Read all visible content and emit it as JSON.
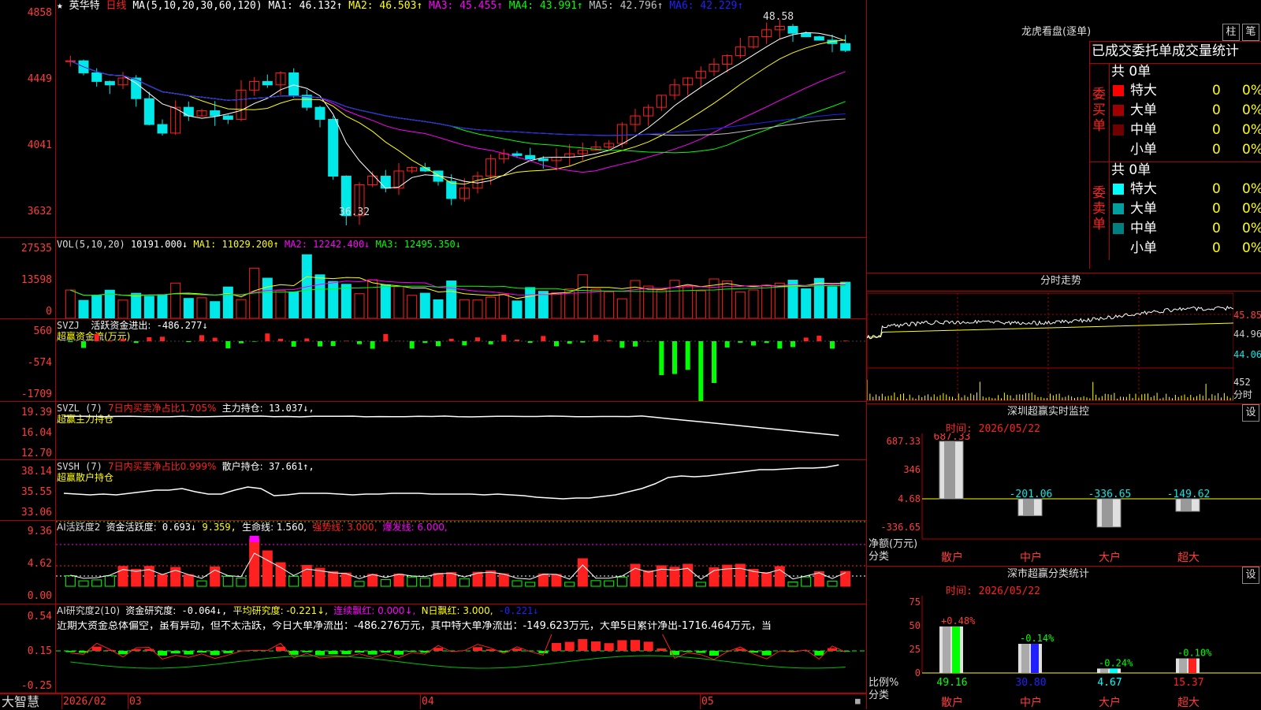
{
  "colors": {
    "up": "#ff2020",
    "down": "#00e8e8",
    "ma1": "#ffffff",
    "ma2": "#ffff00",
    "ma3": "#ff00ff",
    "ma4": "#00ff00",
    "ma5": "#c0c0c0",
    "ma6": "#2020ff",
    "axis": "#ff3c3c",
    "grid": "#b00000"
  },
  "header": {
    "star": "★",
    "name": "英华特",
    "period": "日线",
    "ma_def": "MA(5,10,20,30,60,120)",
    "ma1": "MA1: 46.132↑",
    "ma2": "MA2: 46.503↑",
    "ma3": "MA3: 45.455↑",
    "ma4": "MA4: 43.991↑",
    "ma5": "MA5: 42.796↑",
    "ma6": "MA6: 42.229↑"
  },
  "kline": {
    "yticks": [
      "4858",
      "4449",
      "4041",
      "3632"
    ],
    "high_label": "48.58",
    "low_label": "36.32"
  },
  "vol": {
    "title": "VOL(5,10,20)",
    "v": "10191.000↓",
    "ma1": "MA1: 11029.200↑",
    "ma2": "MA2: 12242.400↓",
    "ma3": "MA3: 12495.350↓",
    "yticks": [
      "27535",
      "13598",
      "0"
    ]
  },
  "svzj": {
    "title": "SVZJ",
    "label": "活跃资金进出:",
    "value": "-486.277↓",
    "subtitle": "超赢资金流(万元)",
    "yticks": [
      "560",
      "-574",
      "-1709"
    ]
  },
  "svzl": {
    "title": "SVZL (7)",
    "ratio": "7日内买卖净占比1.705%",
    "main_label": "主力持仓:",
    "main_value": "13.037↓,",
    "subtitle": "超赢主力持仓",
    "yticks": [
      "19.39",
      "16.04",
      "12.70"
    ]
  },
  "svsh": {
    "title": "SVSH (7)",
    "ratio": "7日内买卖净占比0.999%",
    "label": "散户持仓:",
    "value": "37.661↑,",
    "subtitle": "超赢散户持仓",
    "yticks": [
      "38.14",
      "35.55",
      "33.06"
    ]
  },
  "ai2": {
    "title": "AI活跃度2",
    "label": "资金活跃度:",
    "value": "0.693↓",
    "v2": "9.359,",
    "life": "生命线: 1.560,",
    "strong": "强势线: 3.000,",
    "burst": "爆发线: 6.000,",
    "yticks": [
      "9.36",
      "4.62",
      "0.00"
    ]
  },
  "ai3": {
    "title": "AI研究度2(10)",
    "label": "资金研究度:",
    "value": "-0.064↓,",
    "avg": "平均研究度: -0.221↓,",
    "cont": "连续飘红: 0.000↓,",
    "nday": "N日飘红: 3.000,",
    "last": "-0.221↓",
    "comment": "近期大资金总体偏空，虽有异动，但不太活跃，今日大单净流出：-486.276万元，其中特大单净流出：-149.623万元，大单5日累计净出-1716.464万元，当",
    "yticks": [
      "0.54",
      "0.15",
      "-0.25"
    ]
  },
  "footer": {
    "brand": "大智慧",
    "dates": [
      "2026/02",
      "03",
      "04",
      "05"
    ]
  },
  "lhb": {
    "title": "龙虎看盘(逐单)",
    "btn_zhu": "柱",
    "btn_bi": "笔",
    "header": "已成交委托单成交量统计",
    "buy_label": "委买单",
    "sell_label": "委卖单",
    "buy_total": "共 0单",
    "sell_total": "共 0单",
    "buy_rows": [
      {
        "name": "特大",
        "n": "0",
        "p": "0%",
        "c": "#ff0000"
      },
      {
        "name": "大单",
        "n": "0",
        "p": "0%",
        "c": "#a00000"
      },
      {
        "name": "中单",
        "n": "0",
        "p": "0%",
        "c": "#700000"
      },
      {
        "name": "小单",
        "n": "0",
        "p": "0%",
        "c": "#000000"
      }
    ],
    "sell_rows": [
      {
        "name": "特大",
        "n": "0",
        "p": "0%",
        "c": "#00ffff"
      },
      {
        "name": "大单",
        "n": "0",
        "p": "0%",
        "c": "#00a0a0"
      },
      {
        "name": "中单",
        "n": "0",
        "p": "0%",
        "c": "#008080"
      },
      {
        "name": "小单",
        "n": "0",
        "p": "0%",
        "c": "#000000"
      }
    ]
  },
  "fenshi": {
    "title": "分时走势",
    "yticks": [
      "45.85",
      "44.96",
      "44.06"
    ],
    "vol_tick": "452",
    "vol_label": "分时"
  },
  "sz_monitor": {
    "title": "深圳超赢实时监控",
    "btn": "设",
    "time": "时间: 2026/05/22",
    "yticks": [
      "687.33",
      "346",
      "4.68",
      "-336.65"
    ],
    "ylabel": "净额(万元)",
    "xlabel": "分类",
    "bars": [
      {
        "cat": "散户",
        "val": "687.33"
      },
      {
        "cat": "中户",
        "val": "-201.06"
      },
      {
        "cat": "大户",
        "val": "-336.65"
      },
      {
        "cat": "超大",
        "val": "-149.62"
      }
    ]
  },
  "sz_stat": {
    "title": "深市超赢分类统计",
    "btn": "设",
    "time": "时间: 2026/05/22",
    "yticks": [
      "75",
      "50",
      "25",
      "0"
    ],
    "ylabel": "比例%",
    "xlabel": "分类",
    "bars": [
      {
        "cat": "散户",
        "top": "+0.48%",
        "val": "49.16",
        "c": "#00ff00"
      },
      {
        "cat": "中户",
        "top": "-0.14%",
        "val": "30.80",
        "c": "#2020ff"
      },
      {
        "cat": "大户",
        "top": "-0.24%",
        "val": "4.67",
        "c": "#00ffff"
      },
      {
        "cat": "超大",
        "top": "-0.10%",
        "val": "15.37",
        "c": "#ff2020"
      }
    ]
  }
}
